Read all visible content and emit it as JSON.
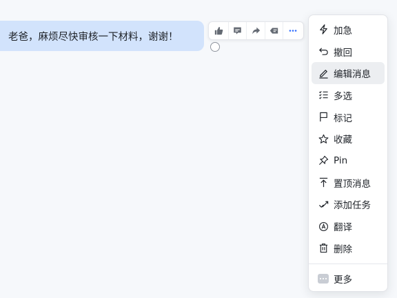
{
  "message": {
    "text": "老爸，麻烦尽快审核一下材料，谢谢！",
    "bubble_color": "#d2e3fc"
  },
  "toolbar": {
    "buttons": [
      {
        "icon": "thumbs-up-icon"
      },
      {
        "icon": "comment-icon"
      },
      {
        "icon": "forward-icon"
      },
      {
        "icon": "quote-reply-icon"
      },
      {
        "icon": "more-icon"
      }
    ],
    "accent": "#3370ff"
  },
  "menu": {
    "items": [
      {
        "label": "加急",
        "icon": "bolt-icon"
      },
      {
        "label": "撤回",
        "icon": "undo-icon"
      },
      {
        "label": "编辑消息",
        "icon": "pencil-icon",
        "active": true
      },
      {
        "label": "多选",
        "icon": "multi-select-icon"
      },
      {
        "label": "标记",
        "icon": "flag-icon"
      },
      {
        "label": "收藏",
        "icon": "star-icon"
      },
      {
        "label": "Pin",
        "icon": "pin-icon"
      },
      {
        "label": "置顶消息",
        "icon": "pin-top-icon"
      },
      {
        "label": "添加任务",
        "icon": "add-task-icon"
      },
      {
        "label": "翻译",
        "icon": "translate-icon"
      },
      {
        "label": "删除",
        "icon": "trash-icon"
      }
    ],
    "more_label": "更多",
    "more_icon": "more-dots-icon"
  }
}
